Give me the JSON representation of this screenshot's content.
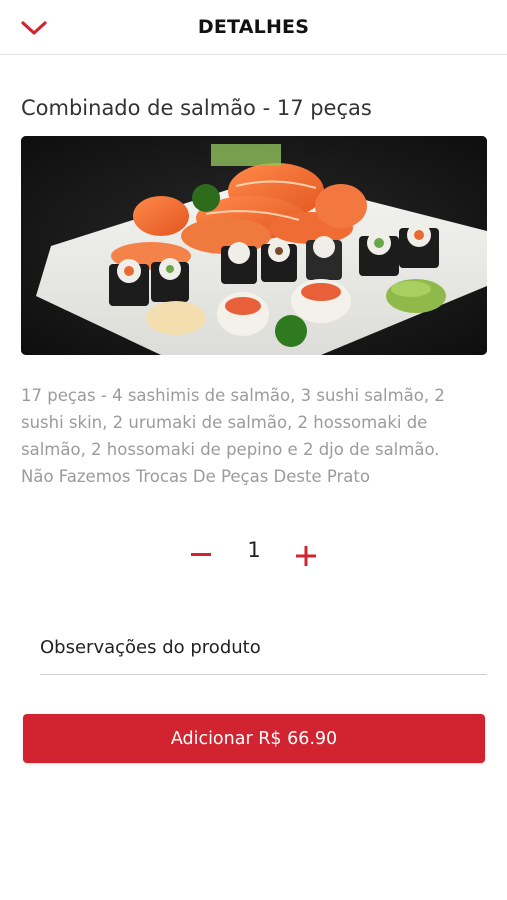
{
  "header": {
    "title": "DETALHES",
    "back_icon": "chevron-down-icon",
    "accent_color": "#d12430"
  },
  "product": {
    "title": "Combinado de salmão - 17 peças",
    "image_alt": "Combinado de salmão - 17 peças",
    "description_lines": [
      "17 peças - 4 sashimis de salmão, 3 sushi salmão, 2",
      "sushi skin, 2 urumaki de salmão, 2 hossomaki de",
      "salmão, 2 hossomaki de pepino e 2 djo de salmão.",
      "Não Fazemos Trocas De Peças Deste Prato"
    ]
  },
  "quantity": {
    "value": "1",
    "minus_icon": "minus-icon",
    "plus_icon": "plus-icon"
  },
  "observations": {
    "placeholder": "Observações do produto",
    "value": ""
  },
  "add_button": {
    "label": "Adicionar R$ 66.90",
    "color": "#d12430"
  }
}
